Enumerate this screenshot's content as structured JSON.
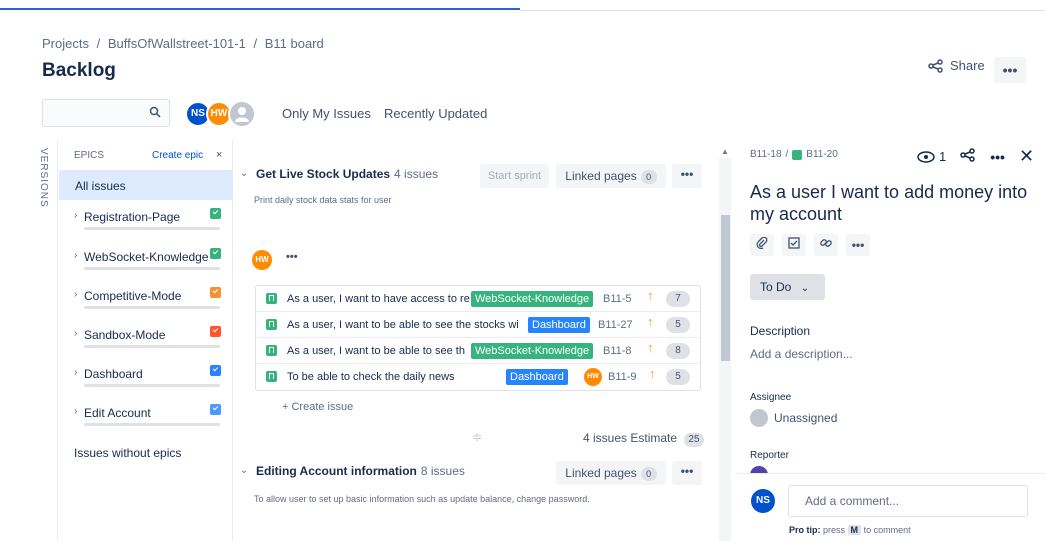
{
  "breadcrumb": {
    "projects": "Projects",
    "sep1": "/",
    "project": "BuffsOfWallstreet-101-1",
    "sep2": "/",
    "board": "B11 board"
  },
  "page": {
    "title": "Backlog"
  },
  "header": {
    "share_label": "Share",
    "more_label": "•••"
  },
  "search": {
    "placeholder": "",
    "icon": "search-icon"
  },
  "avatars": [
    {
      "initials": "NS",
      "color": "#0052cc"
    },
    {
      "initials": "HW",
      "color": "#ff8b00"
    }
  ],
  "filters": {
    "only_my_issues": "Only My Issues",
    "recently_updated": "Recently Updated"
  },
  "versions_tab": {
    "label": "VERSIONS"
  },
  "epics": {
    "title": "EPICS",
    "create_label": "Create epic",
    "close_label": "×",
    "all_issues": "All issues",
    "items": [
      {
        "name": "Registration-Page",
        "color": "#36b37e"
      },
      {
        "name": "WebSocket-Knowledge",
        "color": "#36b37e"
      },
      {
        "name": "Competitive-Mode",
        "color": "#f79233"
      },
      {
        "name": "Sandbox-Mode",
        "color": "#ff5630"
      },
      {
        "name": "Dashboard",
        "color": "#2684ff"
      },
      {
        "name": "Edit Account",
        "color": "#4c9aff"
      }
    ],
    "issues_without_epics": "Issues without epics"
  },
  "sprint1": {
    "name": "Get Live Stock Updates",
    "count": "4 issues",
    "start_label": "Start sprint",
    "linked_label": "Linked pages",
    "linked_count": "0",
    "more_label": "•••",
    "description": "Print daily stock data stats for user",
    "assignee_initials": "HW",
    "assignee_more": "•••",
    "issues": [
      {
        "summary": "As a user, I want to have access to re",
        "epic": "WebSocket-Knowledge",
        "epic_color": "#36b37e",
        "key": "B11-5",
        "priority_icon": "↑",
        "estimate": "7"
      },
      {
        "summary": "As a user, I want to be able to see the stocks wi",
        "epic": "Dashboard",
        "epic_color": "#2684ff",
        "key": "B11-27",
        "priority_icon": "↑",
        "estimate": "5"
      },
      {
        "summary": "As a user, I want to be able to see th",
        "epic": "WebSocket-Knowledge",
        "epic_color": "#36b37e",
        "key": "B11-8",
        "priority_icon": "↑",
        "estimate": "8"
      },
      {
        "summary": "To be able to check the daily news",
        "epic": "Dashboard",
        "epic_color": "#2684ff",
        "key": "B11-9",
        "priority_icon": "↑",
        "estimate": "5",
        "assignee": "HW"
      }
    ],
    "create_issue": "+ Create issue",
    "footer_issues": "4 issues",
    "footer_estimate_label": "Estimate",
    "footer_estimate": "25"
  },
  "sprint2": {
    "name": "Editing Account information",
    "count": "8 issues",
    "linked_label": "Linked pages",
    "linked_count": "0",
    "more_label": "•••",
    "description": "To allow user to set up basic information such as update balance, change password."
  },
  "detail": {
    "parent_key": "B11-18",
    "sep": "/",
    "key": "B11-20",
    "watch_count": "1",
    "title": "As a user I want to add money into my account",
    "status": "To Do",
    "description_label": "Description",
    "description_placeholder": "Add a description...",
    "assignee_label": "Assignee",
    "assignee_value": "Unassigned",
    "reporter_label": "Reporter",
    "comment_avatar": "NS",
    "comment_placeholder": "Add a comment...",
    "pro_tip_label": "Pro tip:",
    "pro_tip_press": "press",
    "pro_tip_key": "M",
    "pro_tip_rest": "to comment"
  }
}
